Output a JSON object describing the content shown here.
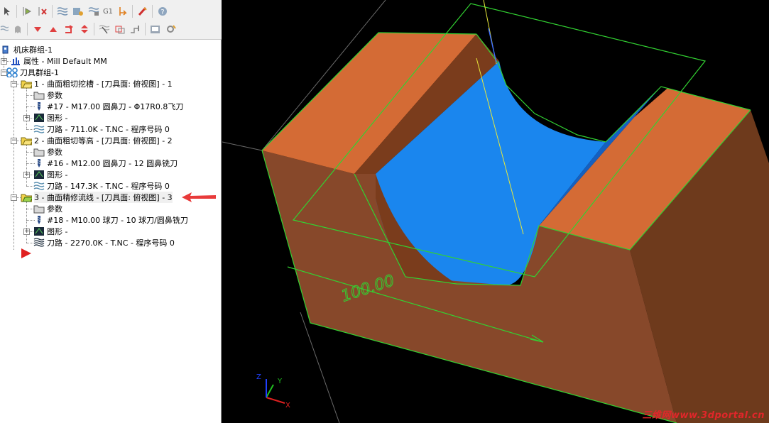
{
  "tree": {
    "machine_group": "机床群组-1",
    "properties": "属性 - Mill Default MM",
    "toolpath_group": "刀具群组-1",
    "operations": [
      {
        "label": "1 - 曲面粗切挖槽 - [刀具面: 俯视图] - 1",
        "params": "参数",
        "tool": "#17 - M17.00 圆鼻刀 - Φ17R0.8飞刀",
        "geometry": "图形 -",
        "toolpath": "刀路 - 711.0K - T.NC - 程序号码 0"
      },
      {
        "label": "2 - 曲面粗切等高 - [刀具面: 俯视图] - 2",
        "params": "参数",
        "tool": "#16 - M12.00 圆鼻刀 - 12 圆鼻铣刀",
        "geometry": "图形 -",
        "toolpath": "刀路 - 147.3K - T.NC - 程序号码 0"
      },
      {
        "label": "3 - 曲面精修流线 - [刀具面: 俯视图] - 3",
        "params": "参数",
        "tool": "#18 - M10.00 球刀 - 10 球刀/圆鼻铣刀",
        "geometry": "图形 -",
        "toolpath": "刀路 - 2270.0K - T.NC - 程序号码 0"
      }
    ]
  },
  "toolbar": {
    "row1_icons": [
      "select-all-icon",
      "select-toolpaths-icon",
      "select-failed-icon",
      "regenerate-icon",
      "regenerate-dirty-icon",
      "backplot-icon",
      "g1-icon",
      "post-icon",
      "highspeed-icon",
      "help-icon"
    ],
    "row1_text": "G1",
    "row2_icons": [
      "lock-icon",
      "ghost-icon",
      "move-down-icon",
      "move-up-icon",
      "insert-arrow-icon",
      "expand-icon",
      "toggle-display-icon",
      "toggle-posting-icon",
      "post-icon-2",
      "tools-manager-icon",
      "settings-icon"
    ]
  },
  "viewport": {
    "dimension_label": "100.00",
    "axes": {
      "x": "X",
      "y": "Y",
      "z": "Z"
    },
    "watermark": "三维网www.3dportal.cn"
  },
  "colors": {
    "part_top": "#d26a36",
    "part_front": "#8a4a22",
    "part_side": "#6a3418",
    "surface_blue": "#1a86ee",
    "wireframe_green": "#32d232",
    "arrow_red": "#e02020",
    "background": "#000000"
  }
}
